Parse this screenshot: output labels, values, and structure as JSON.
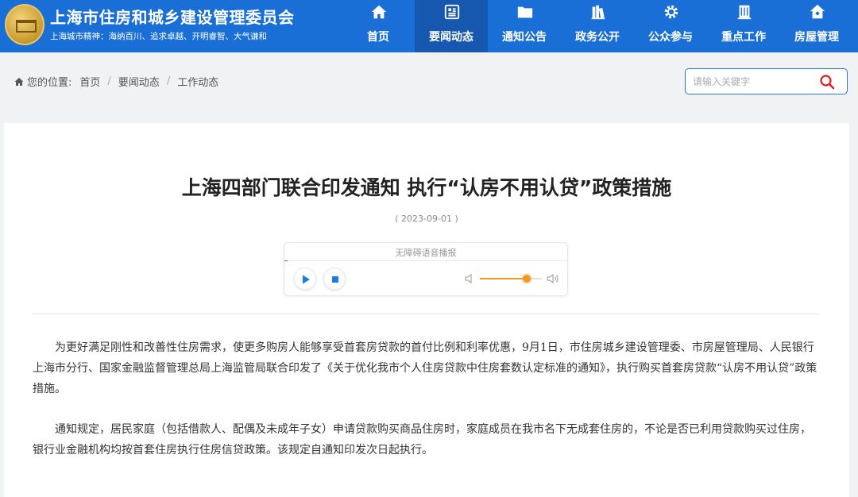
{
  "header": {
    "site_title": "上海市住房和城乡建设管理委员会",
    "slogan": "上海城市精神：海纳百川、追求卓越、开明睿智、大气谦和",
    "brand_color": "#1a6fd6",
    "active_color": "#1657b0",
    "nav": [
      {
        "label": "首页",
        "icon": "home-icon"
      },
      {
        "label": "要闻动态",
        "icon": "news-icon",
        "active": true
      },
      {
        "label": "通知公告",
        "icon": "folder-icon"
      },
      {
        "label": "政务公开",
        "icon": "books-icon"
      },
      {
        "label": "公众参与",
        "icon": "gear-icon"
      },
      {
        "label": "重点工作",
        "icon": "building-icon"
      },
      {
        "label": "房屋管理",
        "icon": "house-icon"
      }
    ]
  },
  "breadcrumb": {
    "prefix": "您的位置:",
    "items": [
      "首页",
      "要闻动态",
      "工作动态"
    ]
  },
  "search": {
    "placeholder": "请输入关键字"
  },
  "article": {
    "title": "上海四部门联合印发通知 执行“认房不用认贷”政策措施",
    "date": "( 2023-09-01 )",
    "player": {
      "label": "无障碍语音播报",
      "progress": 0.01,
      "volume": 0.75,
      "accent_color": "#f29a1f"
    },
    "paragraphs": [
      "为更好满足刚性和改善性住房需求，使更多购房人能够享受首套房贷款的首付比例和利率优惠，9月1日，市住房城乡建设管理委、市房屋管理局、人民银行上海市分行、国家金融监督管理总局上海监管局联合印发了《关于优化我市个人住房贷款中住房套数认定标准的通知》，执行购买首套房贷款“认房不用认贷”政策措施。",
      "通知规定，居民家庭（包括借款人、配偶及未成年子女）申请贷款购买商品住房时，家庭成员在我市名下无成套住房的，不论是否已利用贷款购买过住房，银行业金融机构均按首套住房执行住房信贷政策。该规定自通知印发次日起执行。"
    ]
  }
}
